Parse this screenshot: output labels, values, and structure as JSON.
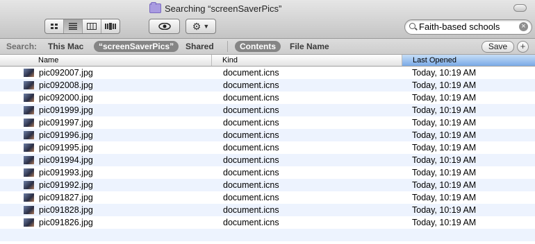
{
  "window": {
    "title": "Searching “screenSaverPics”"
  },
  "search": {
    "query": "Faith-based schools"
  },
  "scope": {
    "label": "Search:",
    "locations": [
      "This Mac",
      "“screenSaverPics”",
      "Shared"
    ],
    "attributes": [
      "Contents",
      "File Name"
    ],
    "save_label": "Save"
  },
  "columns": {
    "name": "Name",
    "kind": "Kind",
    "opened": "Last Opened"
  },
  "files": [
    {
      "name": "pic092007.jpg",
      "kind": "document.icns",
      "opened": "Today, 10:19 AM"
    },
    {
      "name": "pic092008.jpg",
      "kind": "document.icns",
      "opened": "Today, 10:19 AM"
    },
    {
      "name": "pic092000.jpg",
      "kind": "document.icns",
      "opened": "Today, 10:19 AM"
    },
    {
      "name": "pic091999.jpg",
      "kind": "document.icns",
      "opened": "Today, 10:19 AM"
    },
    {
      "name": "pic091997.jpg",
      "kind": "document.icns",
      "opened": "Today, 10:19 AM"
    },
    {
      "name": "pic091996.jpg",
      "kind": "document.icns",
      "opened": "Today, 10:19 AM"
    },
    {
      "name": "pic091995.jpg",
      "kind": "document.icns",
      "opened": "Today, 10:19 AM"
    },
    {
      "name": "pic091994.jpg",
      "kind": "document.icns",
      "opened": "Today, 10:19 AM"
    },
    {
      "name": "pic091993.jpg",
      "kind": "document.icns",
      "opened": "Today, 10:19 AM"
    },
    {
      "name": "pic091992.jpg",
      "kind": "document.icns",
      "opened": "Today, 10:19 AM"
    },
    {
      "name": "pic091827.jpg",
      "kind": "document.icns",
      "opened": "Today, 10:19 AM"
    },
    {
      "name": "pic091828.jpg",
      "kind": "document.icns",
      "opened": "Today, 10:19 AM"
    },
    {
      "name": "pic091826.jpg",
      "kind": "document.icns",
      "opened": "Today, 10:19 AM"
    }
  ]
}
